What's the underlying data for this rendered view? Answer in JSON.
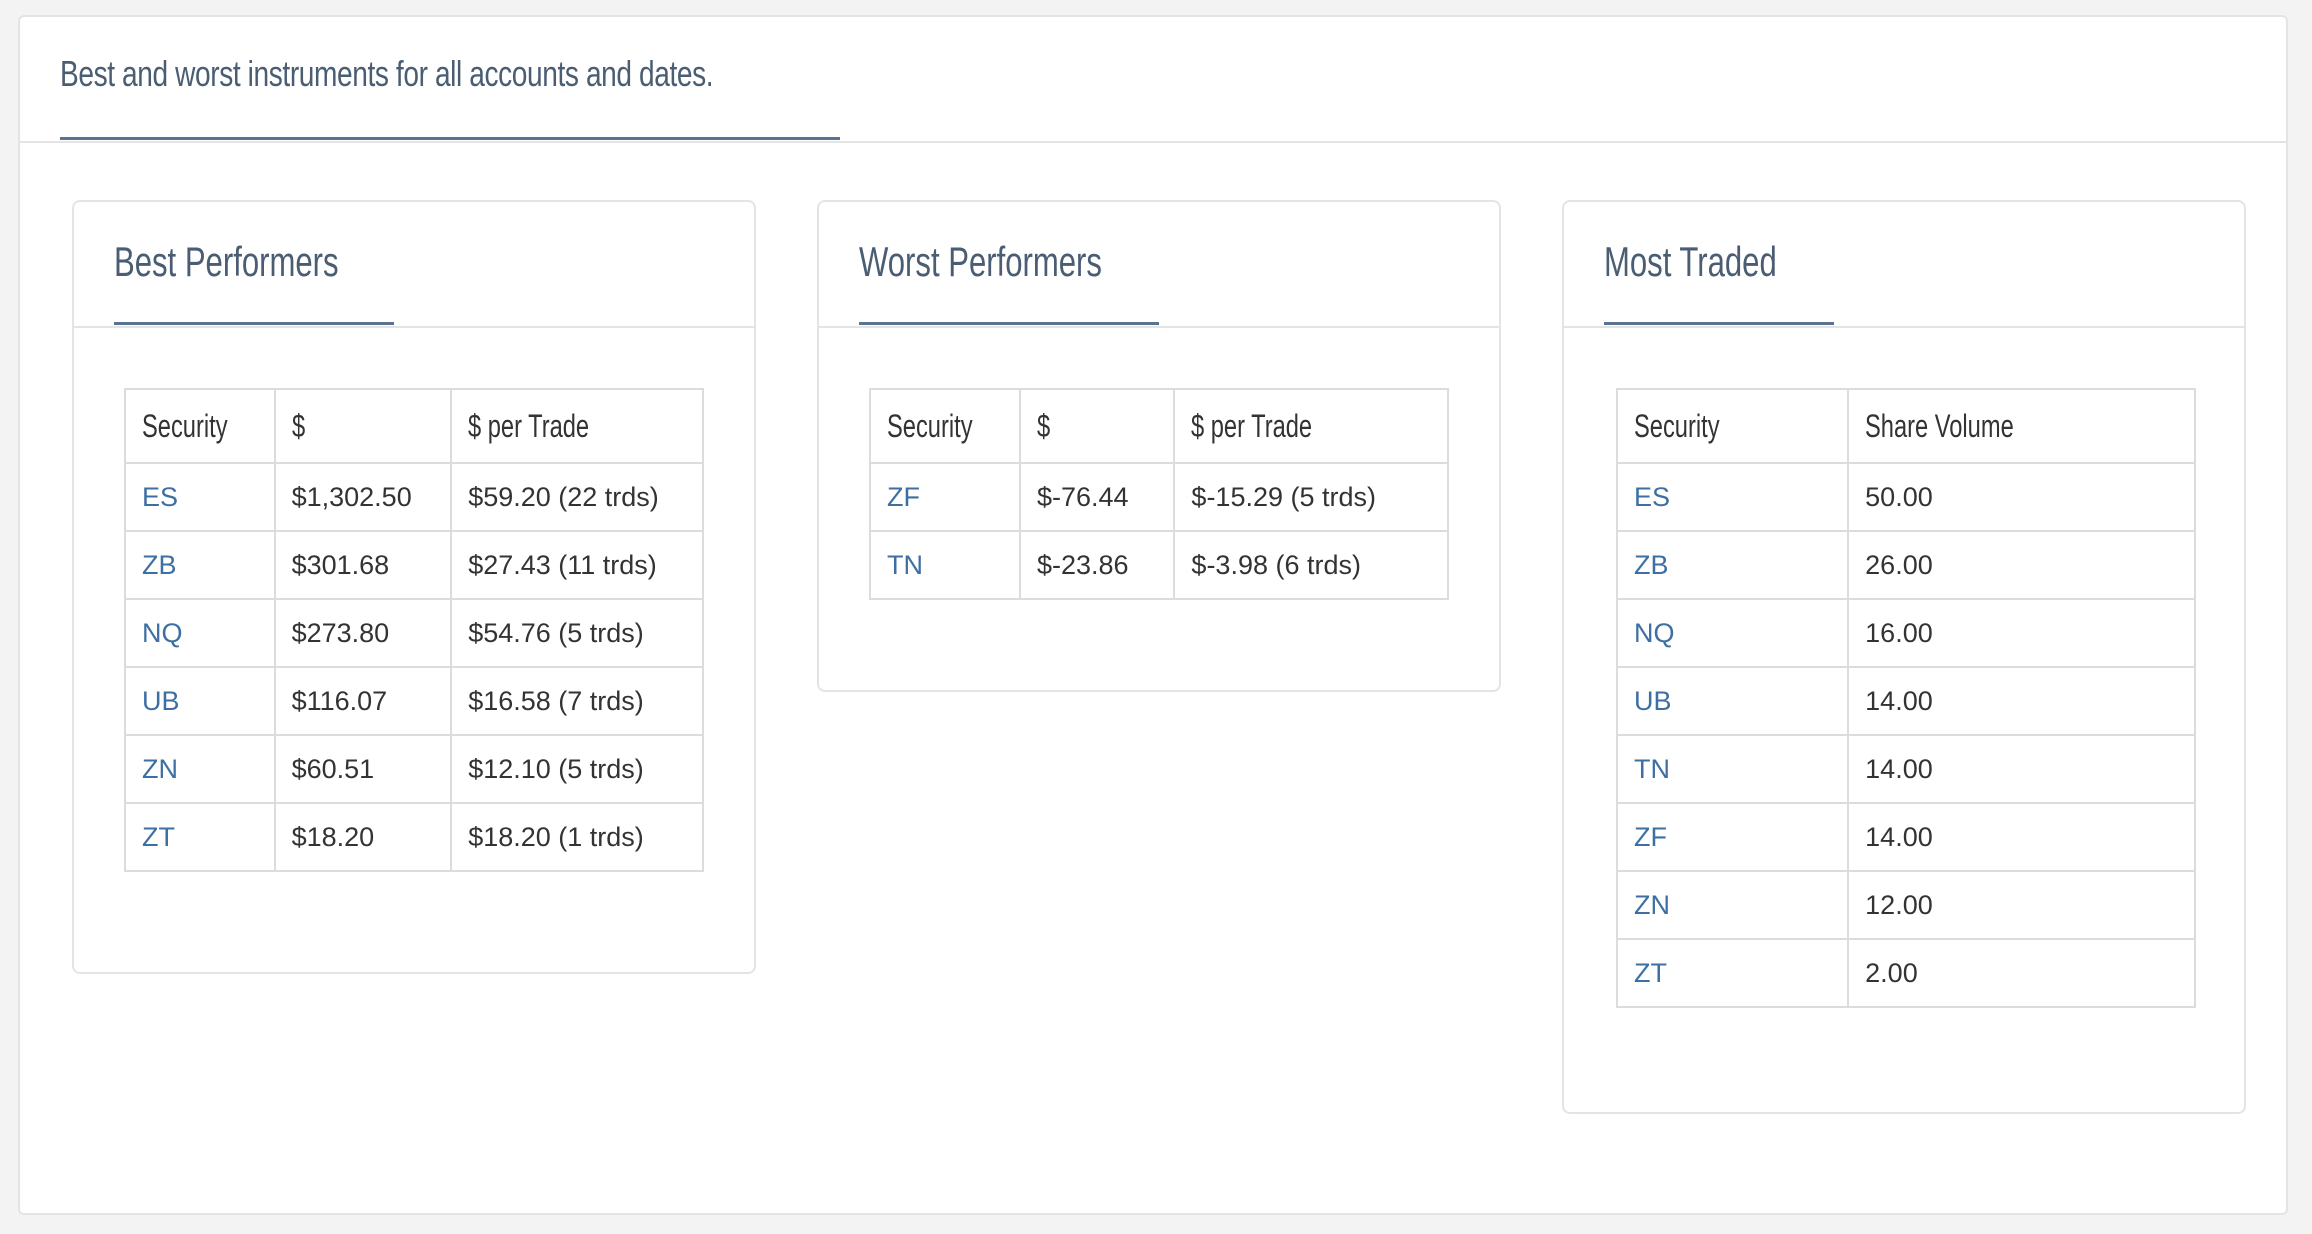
{
  "page": {
    "title": "Best and worst instruments for all accounts and dates."
  },
  "best": {
    "title": "Best Performers",
    "columns": [
      "Security",
      "$",
      "$ per Trade"
    ],
    "rows": [
      [
        "ES",
        "$1,302.50",
        "$59.20 (22 trds)"
      ],
      [
        "ZB",
        "$301.68",
        "$27.43 (11 trds)"
      ],
      [
        "NQ",
        "$273.80",
        "$54.76 (5 trds)"
      ],
      [
        "UB",
        "$116.07",
        "$16.58 (7 trds)"
      ],
      [
        "ZN",
        "$60.51",
        "$12.10 (5 trds)"
      ],
      [
        "ZT",
        "$18.20",
        "$18.20 (1 trds)"
      ]
    ]
  },
  "worst": {
    "title": "Worst Performers",
    "columns": [
      "Security",
      "$",
      "$ per Trade"
    ],
    "rows": [
      [
        "ZF",
        "$-76.44",
        "$-15.29 (5 trds)"
      ],
      [
        "TN",
        "$-23.86",
        "$-3.98 (6 trds)"
      ]
    ]
  },
  "most": {
    "title": "Most Traded",
    "columns": [
      "Security",
      "Share Volume"
    ],
    "rows": [
      [
        "ES",
        "50.00"
      ],
      [
        "ZB",
        "26.00"
      ],
      [
        "NQ",
        "16.00"
      ],
      [
        "UB",
        "14.00"
      ],
      [
        "TN",
        "14.00"
      ],
      [
        "ZF",
        "14.00"
      ],
      [
        "ZN",
        "12.00"
      ],
      [
        "ZT",
        "2.00"
      ]
    ]
  }
}
